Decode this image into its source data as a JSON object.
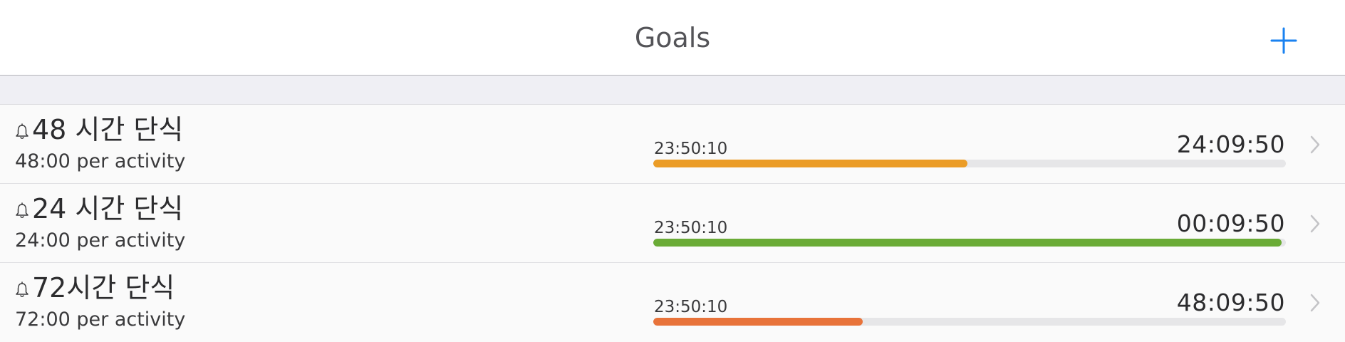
{
  "header": {
    "title": "Goals"
  },
  "goals": [
    {
      "title": "48 시간 단식",
      "subtitle": "48:00 per activity",
      "elapsed": "23:50:10",
      "remaining": "24:09:50",
      "progress": 0.4965,
      "color": "#eb9c26"
    },
    {
      "title": "24 시간 단식",
      "subtitle": "24:00 per activity",
      "elapsed": "23:50:10",
      "remaining": "00:09:50",
      "progress": 0.9931,
      "color": "#6aab36"
    },
    {
      "title": "72시간 단식",
      "subtitle": "72:00 per activity",
      "elapsed": "23:50:10",
      "remaining": "48:09:50",
      "progress": 0.331,
      "color": "#e8733a"
    }
  ],
  "colors": {
    "accent": "#1a82f0",
    "separator": "#e0e0e3",
    "track": "#e6e6e8"
  },
  "icons": {
    "add": "plus-icon",
    "alarm": "bell-icon",
    "disclosure": "chevron-right-icon"
  }
}
